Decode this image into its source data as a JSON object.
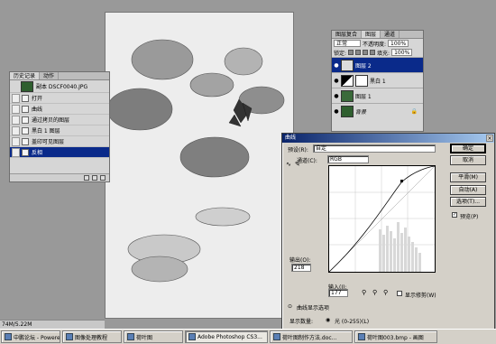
{
  "canvas_status": "74M/5.22M",
  "history": {
    "tabs": [
      "历史记录",
      "动作"
    ],
    "snapshot": "副本 DSCF0040.JPG",
    "items": [
      "打开",
      "曲线",
      "通过拷贝的图层",
      "黑白 1 图层",
      "盖印可见图层",
      "反相"
    ]
  },
  "layers": {
    "tabs": [
      "图层复合",
      "图层",
      "通道"
    ],
    "blend_mode": "正常",
    "opacity_label": "不透明度:",
    "opacity_value": "100%",
    "lock_label": "锁定:",
    "fill_label": "填充:",
    "fill_value": "100%",
    "rows": [
      {
        "name": "图层 2",
        "selected": true
      },
      {
        "name": "黑白 1",
        "selected": false
      },
      {
        "name": "图层 1",
        "selected": false
      },
      {
        "name": "背景",
        "selected": false
      }
    ]
  },
  "curves": {
    "title": "曲线",
    "preset_label": "预设(R):",
    "preset_value": "自定",
    "channel_label": "通道(C):",
    "channel_value": "RGB",
    "output_label": "输出(O):",
    "output_value": "218",
    "input_label": "输入(I):",
    "input_value": "177",
    "clip_label": "显示修剪(W)",
    "display_options": "曲线显示选项",
    "show_amount_label": "显示数量:",
    "light_option": "光 (0-255)(L)",
    "preview_label": "预览(P)",
    "buttons": {
      "ok": "确定",
      "cancel": "取消",
      "smooth": "平滑(M)",
      "auto": "自动(A)",
      "options": "选项(T)..."
    }
  },
  "taskbar": {
    "items": [
      {
        "label": "中鹏论坛 - Powered ..."
      },
      {
        "label": "图像处理教程"
      },
      {
        "label": "荷叶图"
      },
      {
        "label": "Adobe Photoshop CS3..."
      },
      {
        "label": "荷叶图制作方法.doc..."
      },
      {
        "label": "荷叶图003.bmp - 画图"
      }
    ]
  }
}
